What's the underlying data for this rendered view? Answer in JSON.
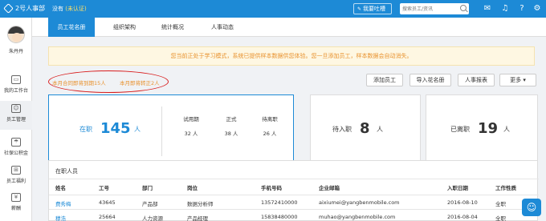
{
  "app": {
    "name": "2号人事部",
    "company": "没有",
    "cert_status": "(未认证)"
  },
  "topbar": {
    "punch_button": "我要吐槽",
    "search_placeholder": "搜索员工/资讯",
    "icons": [
      "message-icon",
      "bell-icon",
      "help-icon",
      "gear-icon"
    ]
  },
  "sidebar": {
    "username": "朱丹丹",
    "items": [
      {
        "label": "我的工作台",
        "icon": "monitor-icon",
        "glyph": "▭"
      },
      {
        "label": "员工管理",
        "icon": "id-card-icon",
        "glyph": "☺"
      },
      {
        "label": "社保公积金",
        "icon": "umbrella-icon",
        "glyph": "☂"
      },
      {
        "label": "员工福利",
        "icon": "gift-icon",
        "glyph": "⊞"
      },
      {
        "label": "薪酬",
        "icon": "money-icon",
        "glyph": "¥"
      }
    ]
  },
  "tabs": [
    "员工花名册",
    "组织架构",
    "统计概况",
    "人事动态"
  ],
  "notice": "您当前正处于学习模式，系统已提供样本数据供您体验。您一旦添加员工，样本数据会自动消失。",
  "alerts": [
    "本月合同即将到期15人",
    "本月即将转正2人"
  ],
  "actions": [
    "添加员工",
    "导入花名册",
    "人事报表",
    "更多 ▾"
  ],
  "stats": {
    "active": {
      "label": "在职",
      "value": "145",
      "unit": "人"
    },
    "breakdown": [
      {
        "label": "试用期",
        "value": "32 人"
      },
      {
        "label": "正式",
        "value": "38 人"
      },
      {
        "label": "待离职",
        "value": "26 人"
      }
    ],
    "pending": {
      "label": "待入职",
      "value": "8",
      "unit": "人"
    },
    "left": {
      "label": "已离职",
      "value": "19",
      "unit": "人"
    }
  },
  "table": {
    "title": "在职人员",
    "headers": [
      "姓名",
      "工号",
      "部门",
      "岗位",
      "手机号码",
      "企业邮箱",
      "入职日期",
      "工作性质"
    ],
    "rows": [
      [
        "费秀梅",
        "43645",
        "产品部",
        "数据分析师",
        "13572410000",
        "aixiumei@yangbenmobile.com",
        "2016-08-10",
        "全职"
      ],
      [
        "穆浩",
        "25664",
        "人力资源",
        "产品经理",
        "15838480000",
        "muhao@yangbenmobile.com",
        "2016-08-04",
        "全职"
      ]
    ]
  },
  "colors": {
    "primary": "#1d8ad6",
    "warning": "#e8922e",
    "alert_circle": "#d81b1b"
  }
}
